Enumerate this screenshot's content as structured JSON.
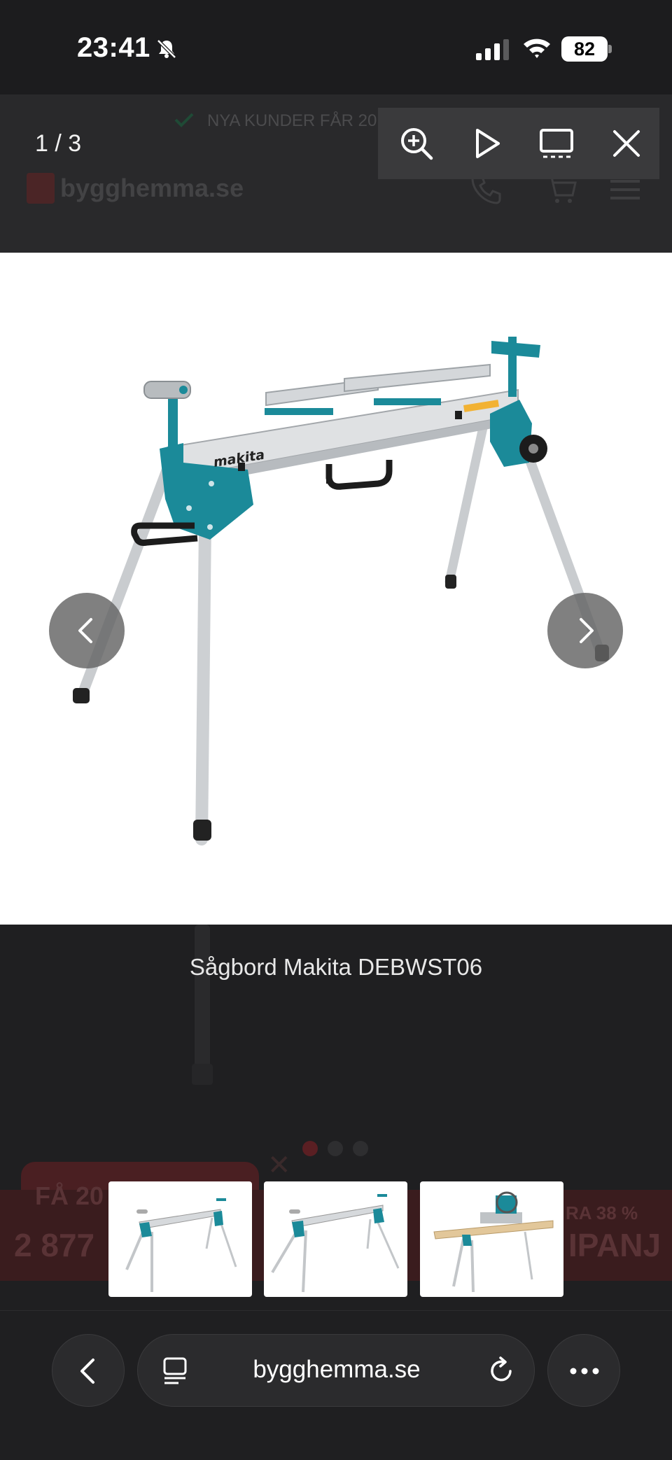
{
  "status": {
    "time": "23:41",
    "battery": "82"
  },
  "page": {
    "promo": "NYA KUNDER FÅR 20",
    "site_name": "bygghemma.se",
    "badge_text": "FÅ 20",
    "price_partial": "2 877",
    "discount_partial": "RA 38 %",
    "code_partial": "IPANJ"
  },
  "lightbox": {
    "counter": "1 / 3",
    "caption": "Sågbord Makita DEBWST06",
    "brand_label": "makita"
  },
  "browser": {
    "url": "bygghemma.se"
  },
  "colors": {
    "makita_teal": "#1b8a99",
    "brand_red": "#c8102e"
  }
}
